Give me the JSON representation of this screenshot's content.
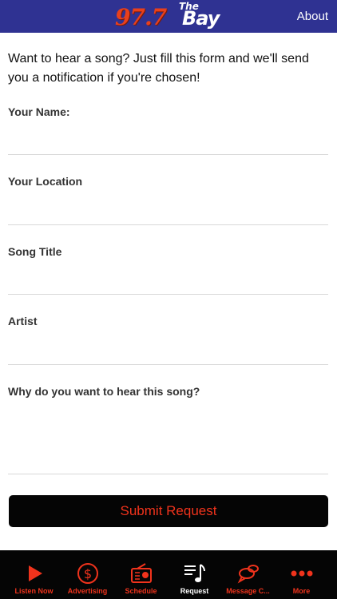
{
  "header": {
    "logo_number": "97.7",
    "logo_the": "The",
    "logo_bay": "Bay",
    "about_label": "About"
  },
  "form": {
    "intro": "Want to hear a song? Just fill this form and we'll send you a notification if you're chosen!",
    "fields": [
      {
        "label": "Your Name:",
        "value": ""
      },
      {
        "label": "Your Location",
        "value": ""
      },
      {
        "label": "Song Title",
        "value": ""
      },
      {
        "label": "Artist",
        "value": ""
      },
      {
        "label": "Why do you want to hear this song?",
        "value": ""
      }
    ],
    "submit_label": "Submit Request"
  },
  "tabbar": {
    "items": [
      {
        "label": "Listen Now",
        "icon": "play-icon",
        "active": false
      },
      {
        "label": "Advertising",
        "icon": "dollar-icon",
        "active": false
      },
      {
        "label": "Schedule",
        "icon": "radio-icon",
        "active": false
      },
      {
        "label": "Request",
        "icon": "music-list-icon",
        "active": true
      },
      {
        "label": "Message C...",
        "icon": "chat-bubbles-icon",
        "active": false
      },
      {
        "label": "More",
        "icon": "more-dots-icon",
        "active": false
      }
    ]
  },
  "colors": {
    "header_bg": "#2f3292",
    "accent_red": "#f0331c",
    "tabbar_bg": "#050505"
  }
}
